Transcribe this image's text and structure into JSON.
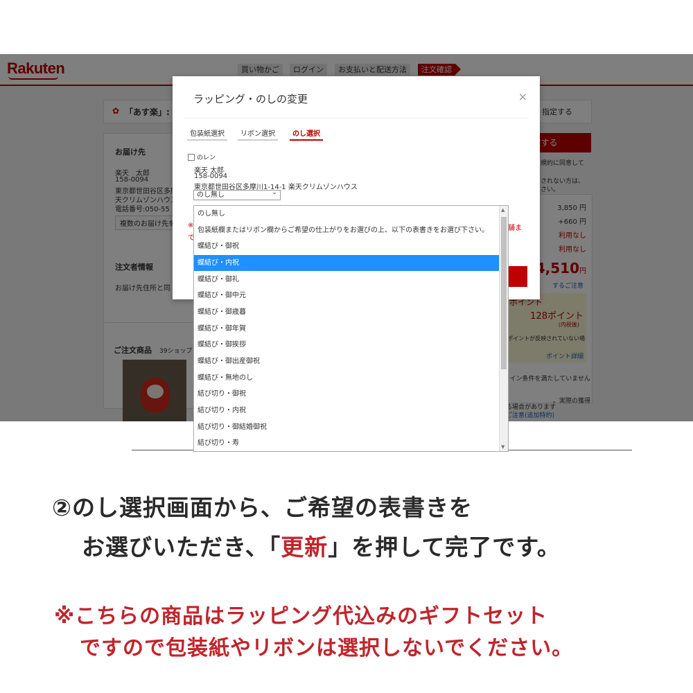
{
  "header": {
    "logo": "Rakuten",
    "steps": [
      "買い物かご",
      "ログイン",
      "お支払いと配送方法",
      "注文確認"
    ]
  },
  "background": {
    "banner_text": "「あす楽」:",
    "banner_right": "指定する",
    "delivery_title": "お届け先",
    "delivery_lines": [
      "楽天　太郎",
      "158-0094",
      "東京都世田谷区多摩",
      "天クリムゾンハウス",
      "電話番号:050-55"
    ],
    "multi_button": "複数のお届け先を",
    "orderer_title": "注文者情報",
    "orderer_text": "お届け先住所と同",
    "products_title": "ご注文商品",
    "products_shop": "39ショップ",
    "confirm_button": "定する",
    "notes": [
      "規約に同意して",
      "されない方は、",
      "さい。"
    ],
    "prices": [
      "3,850 円",
      "+660 円",
      "利用なし",
      "利用なし"
    ],
    "total": "4,510",
    "total_unit": "円",
    "total_note": "するご注意",
    "points_label": "ポイント",
    "points_value": "128ポイント",
    "points_sub": "(内税後)",
    "points_note": "・ポイントが反映されていない場",
    "points_link": "ポイント詳細",
    "extra_notes": [
      "ライン条件を満たしていません",
      "。実際の獲得",
      "る場合があります",
      "ご注意(追加特約)"
    ],
    "red_note_right": "舗ま",
    "red_note_left": "※",
    "red_note_left2": "で"
  },
  "modal": {
    "title": "ラッピング・のしの変更",
    "close": "×",
    "tabs": [
      "包装紙選択",
      "リボン選択",
      "のし選択"
    ],
    "active_tab": 2,
    "section_label": "のレン",
    "address_lines": [
      "楽天 太郎",
      "158-0094",
      "東京都世田谷区多摩川1-14-1 楽天クリムゾンハウス"
    ],
    "select_value": "のし無し",
    "select_arrow": "⌄"
  },
  "dropdown": {
    "selected_index": 3,
    "options": [
      "のし無し",
      "包装紙欄またはリボン欄からご希望の仕上がりをお選びの上、以下の表書きをお選び下さい。",
      "蝶結び・御祝",
      "蝶結び・内祝",
      "蝶結び・御礼",
      "蝶結び・御中元",
      "蝶結び・御歳暮",
      "蝶結び・御年賀",
      "蝶結び・御挨拶",
      "蝶結び・御出産御祝",
      "蝶結び・無地のし",
      "結び切り・御祝",
      "結び切り・内祝",
      "結び切り・御結婚御祝",
      "結び切り・寿"
    ]
  },
  "caption": {
    "line1": "②のし選択画面から、ご希望の表書きを",
    "line2_a": "お選びいただき、「",
    "line2_b": "更新",
    "line2_c": "」を押して完了です。",
    "note1": "※こちらの商品はラッピング代込みのギフトセット",
    "note2": "ですので包装紙やリボンは選択しないでください。",
    "accent_color": "#c0252c"
  }
}
